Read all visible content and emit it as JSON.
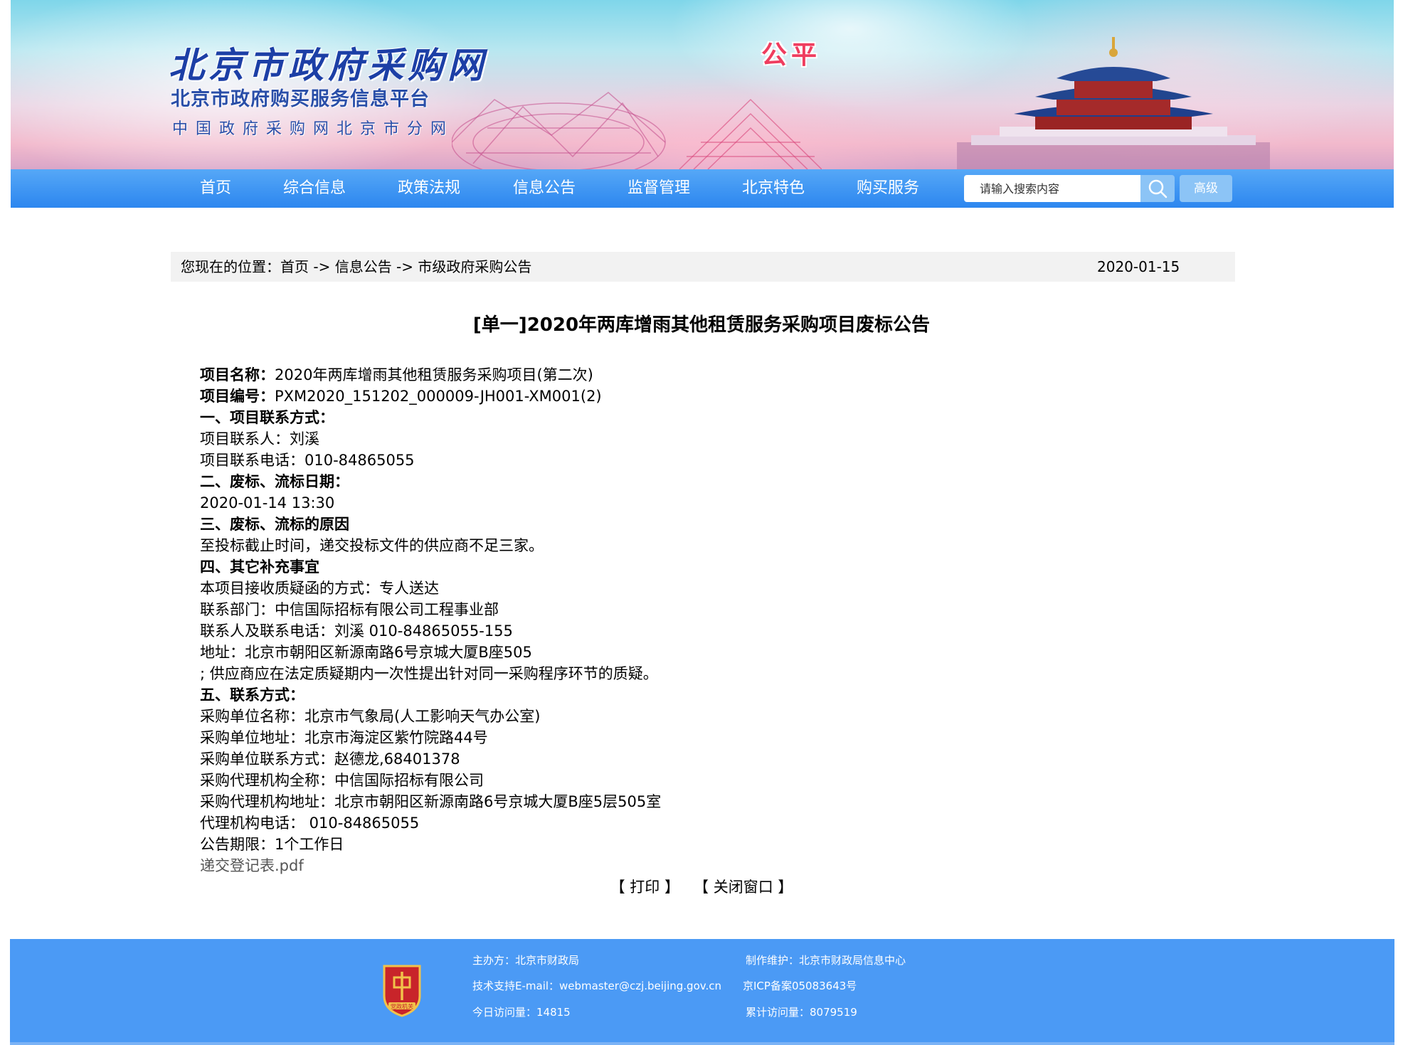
{
  "header": {
    "logo_main": "北京市政府采购网",
    "logo_sub1": "北京市政府购买服务信息平台",
    "logo_sub2": "中国政府采购网北京市分网",
    "motto": "公平"
  },
  "nav": {
    "items": [
      "首页",
      "综合信息",
      "政策法规",
      "信息公告",
      "监督管理",
      "北京特色",
      "购买服务"
    ],
    "search_placeholder": "请输入搜索内容",
    "advanced_label": "高级"
  },
  "breadcrumb": {
    "prefix": "您现在的位置：",
    "home": "首页",
    "sep": " -> ",
    "level1": "信息公告",
    "level2": "市级政府采购公告",
    "date": "2020-01-15"
  },
  "article": {
    "title": "[单一]2020年两库增雨其他租赁服务采购项目废标公告",
    "project_name_label": "项目名称：",
    "project_name": "2020年两库增雨其他租赁服务采购项目(第二次)",
    "project_no_label": "项目编号：",
    "project_no": "PXM2020_151202_000009-JH001-XM001(2)",
    "s1_heading": "一、项目联系方式：",
    "s1_contact": "项目联系人：刘溪",
    "s1_phone": "项目联系电话：010-84865055",
    "s2_heading": "二、废标、流标日期：",
    "s2_date": "2020-01-14 13:30",
    "s3_heading": "三、废标、流标的原因",
    "s3_reason": "至投标截止时间，递交投标文件的供应商不足三家。",
    "s4_heading": "四、其它补充事宜",
    "s4_l1": "本项目接收质疑函的方式：专人送达",
    "s4_l2": "联系部门：中信国际招标有限公司工程事业部",
    "s4_l3": "联系人及联系电话：刘溪 010-84865055-155",
    "s4_l4": "地址：北京市朝阳区新源南路6号京城大厦B座505",
    "s4_l5": "; 供应商应在法定质疑期内一次性提出针对同一采购程序环节的质疑。",
    "s5_heading": "五、联系方式：",
    "s5_l1": "采购单位名称：北京市气象局(人工影响天气办公室)",
    "s5_l2": "采购单位地址：北京市海淀区紫竹院路44号",
    "s5_l3": "采购单位联系方式：赵德龙,68401378",
    "s5_l4": "采购代理机构全称：中信国际招标有限公司",
    "s5_l5": "采购代理机构地址：北京市朝阳区新源南路6号京城大厦B座5层505室",
    "s5_l6": "代理机构电话： 010-84865055",
    "s5_l7": "公告期限：1个工作日",
    "attachment": "递交登记表.pdf"
  },
  "actions": {
    "open_bracket": "【",
    "close_bracket": "】",
    "print": "打印",
    "close": "关闭窗口"
  },
  "footer": {
    "host": "主办方：北京市财政局",
    "maintainer": "制作维护：北京市财政局信息中心",
    "support": "技术支持E-mail：webmaster@czj.beijing.gov.cn",
    "icp": "京ICP备案05083643号",
    "today_visits": "今日访问量：14815",
    "total_visits": "累计访问量：8079519",
    "emblem_text": "党政机关"
  },
  "colors": {
    "nav_blue": "#2c86ef",
    "footer_blue": "#4b9af5",
    "logo_blue": "#1c3fa6",
    "motto_red": "#ef3d5f"
  },
  "icons": [
    "search-icon",
    "temple-of-heaven-illustration",
    "birds-nest-illustration",
    "party-government-emblem"
  ]
}
